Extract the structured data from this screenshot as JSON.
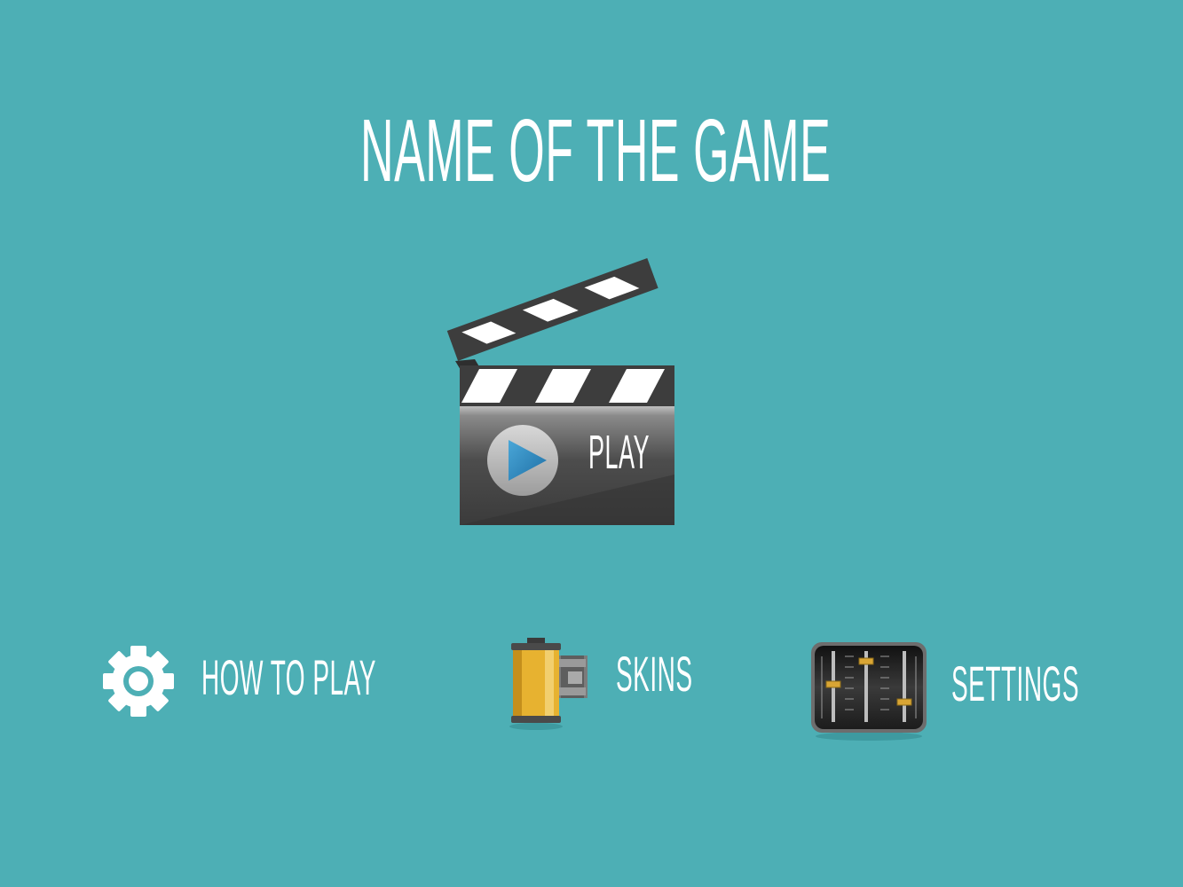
{
  "title": "NAME OF THE GAME",
  "play": {
    "label": "PLAY",
    "icon": "clapperboard-icon"
  },
  "menu": {
    "how_to_play": {
      "label": "HOW TO PLAY",
      "icon": "gear-icon"
    },
    "skins": {
      "label": "SKINS",
      "icon": "film-roll-icon"
    },
    "settings": {
      "label": "SETTINGS",
      "icon": "mixer-sliders-icon"
    }
  },
  "colors": {
    "background": "#4dafb5",
    "text": "#ffffff",
    "clapper_dark": "#3d3d3d",
    "film_yellow": "#e7b230",
    "slider_knob": "#d9a534"
  }
}
